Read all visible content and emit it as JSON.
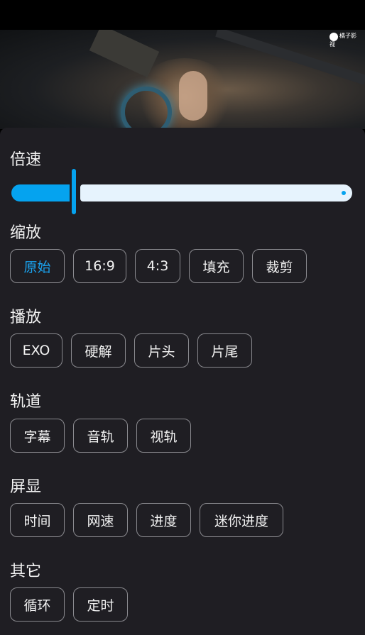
{
  "video": {
    "watermark": "橘子影视"
  },
  "sections": {
    "speed": {
      "title": "倍速",
      "value_fraction": 0.18
    },
    "zoom": {
      "title": "缩放",
      "options": [
        "原始",
        "16:9",
        "4:3",
        "填充",
        "裁剪"
      ],
      "selected": "原始"
    },
    "play": {
      "title": "播放",
      "options": [
        "EXO",
        "硬解",
        "片头",
        "片尾"
      ]
    },
    "track": {
      "title": "轨道",
      "options": [
        "字幕",
        "音轨",
        "视轨"
      ]
    },
    "screen": {
      "title": "屏显",
      "options": [
        "时间",
        "网速",
        "进度",
        "迷你进度"
      ]
    },
    "other": {
      "title": "其它",
      "options": [
        "循环",
        "定时"
      ]
    }
  },
  "colors": {
    "accent": "#05a3ef",
    "panel_bg": "#1f1e23",
    "chip_border": "#8a8a8f"
  }
}
